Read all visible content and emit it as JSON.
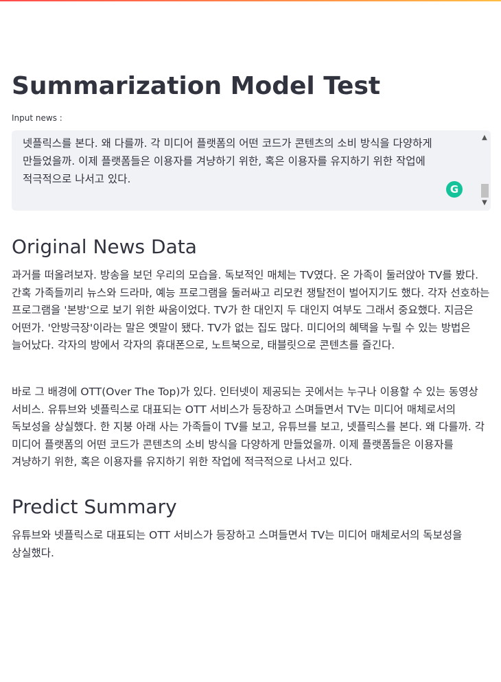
{
  "page": {
    "title": "Summarization Model Test"
  },
  "input": {
    "label": "Input news :",
    "visible_text": "미디어 매체로서의 독보성을 상실했다. 한 지붕 아래 사는 가족들이 TV를 보고, 유튜브를 보고, 넷플릭스를 본다. 왜 다를까. 각 미디어 플랫폼의 어떤 코드가 콘텐츠의 소비 방식을 다양하게 만들었을까. 이제 플랫폼들은 이용자를 겨냥하기 위한, 혹은 이용자를 유지하기 위한 작업에 적극적으로 나서고 있다.",
    "grammarly_glyph": "G",
    "scroll_up_glyph": "▲",
    "scroll_down_glyph": "▼"
  },
  "original": {
    "heading": "Original News Data",
    "paragraphs": [
      "과거를 떠올려보자. 방송을 보던 우리의 모습을. 독보적인 매체는 TV였다. 온 가족이 둘러앉아 TV를 봤다. 간혹 가족들끼리 뉴스와 드라마, 예능 프로그램을 둘러싸고 리모컨 쟁탈전이 벌어지기도 했다. 각자 선호하는 프로그램을 '본방'으로 보기 위한 싸움이었다. TV가 한 대인지 두 대인지 여부도 그래서 중요했다. 지금은 어떤가. '안방극장'이라는 말은 옛말이 됐다. TV가 없는 집도 많다. 미디어의 혜택을 누릴 수 있는 방법은 늘어났다. 각자의 방에서 각자의 휴대폰으로, 노트북으로, 태블릿으로 콘텐츠를 즐긴다.",
      "바로 그 배경에 OTT(Over The Top)가 있다. 인터넷이 제공되는 곳에서는 누구나 이용할 수 있는 동영상 서비스. 유튜브와 넷플릭스로 대표되는 OTT 서비스가 등장하고 스며들면서 TV는 미디어 매체로서의 독보성을 상실했다. 한 지붕 아래 사는 가족들이 TV를 보고, 유튜브를 보고, 넷플릭스를 본다. 왜 다를까. 각 미디어 플랫폼의 어떤 코드가 콘텐츠의 소비 방식을 다양하게 만들었을까. 이제 플랫폼들은 이용자를 겨냥하기 위한, 혹은 이용자를 유지하기 위한 작업에 적극적으로 나서고 있다."
    ]
  },
  "summary": {
    "heading": "Predict Summary",
    "text": "유튜브와 넷플릭스로 대표되는 OTT 서비스가 등장하고 스며들면서 TV는 미디어 매체로서의 독보성을 상실했다."
  },
  "colors": {
    "text": "#31333f",
    "textarea_bg": "#f0f2f6",
    "grammarly": "#15c39a",
    "topbar_start": "#ff4b4b",
    "topbar_end": "#ffbd45"
  }
}
